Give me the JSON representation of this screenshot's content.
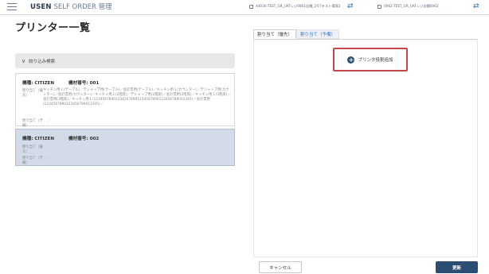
{
  "header": {
    "brand_bold": "USEN",
    "brand_rest": " SELF ORDER 管理",
    "store_left": "A4030:TEST_GR_UATレジ0061店舗_2/17テスト環境2",
    "store_right": "0062:TEST_GR_UATレジ店舗0062",
    "swap_glyph": "⇄"
  },
  "page": {
    "title": "プリンター一覧",
    "filter_label": "絞り込み検索",
    "filter_chevron": "∨"
  },
  "printers": [
    {
      "model_label": "機種: CITIZEN",
      "number_label": "機材番号: 001",
      "priority_label": "割り当て（優先）",
      "priority_value": "キッチン用１(テーブル)／デシャップ用(テーブル)／会計票用(テーブル)／キッチン用１(カウンター)／デシャップ用(カウンター)／会計票用(カウンター)／キッチン用１(2階席)／デシャップ用(2階席)／会計票用(2階席)／キッチン用１(3階席)／会計票用(3階席)／キッチン用１(123456789012345678901234567890123456789012345)／会計票用(1234567890123456789012345)／",
      "reserve_label": "割り当て（予備）",
      "reserve_value": "／"
    },
    {
      "model_label": "機種: CITIZEN",
      "number_label": "機材番号: 002",
      "priority_label": "割り当て（優先）",
      "priority_value": "／",
      "reserve_label": "割り当て（予備）",
      "reserve_value": "／"
    }
  ],
  "tabs": [
    {
      "label": "割り当て（優先）",
      "active": true
    },
    {
      "label": "割り当て（予備）",
      "active": false
    }
  ],
  "actions": {
    "add_printer": "プリンタ役割追加",
    "add_icon": "+",
    "cancel": "キャンセル",
    "update": "更新"
  },
  "colors": {
    "accent": "#2d4e73",
    "highlight": "#c8464a",
    "selected_card": "#d3dbe8"
  }
}
